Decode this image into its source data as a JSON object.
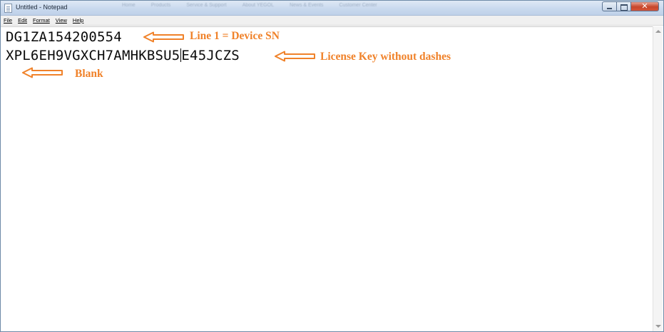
{
  "window": {
    "title": "Untitled - Notepad",
    "ghost_menu": [
      "Home",
      "Products",
      "Service & Support",
      "About YEGOL",
      "News & Events",
      "Customer Center"
    ]
  },
  "menubar": {
    "items": [
      "File",
      "Edit",
      "Format",
      "View",
      "Help"
    ]
  },
  "editor": {
    "line1": "DG1ZA154200554",
    "line2_before_caret": "XPL6EH9VGXCH7AMHKBSU5",
    "line2_after_caret": "E45JCZS"
  },
  "annotations": {
    "line1": "Line 1 = Device SN",
    "line2": "License Key without dashes",
    "line3": "Blank",
    "color": "#f0822a"
  },
  "icons": {
    "app": "notepad-icon",
    "minimize": "minimize-icon",
    "maximize": "maximize-icon",
    "close": "close-icon",
    "arrow": "left-arrow-icon"
  }
}
